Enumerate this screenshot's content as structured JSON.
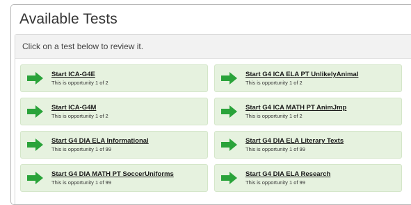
{
  "title": "Available Tests",
  "instructions": "Click on a test below to review it.",
  "tests": [
    {
      "label": "Start ICA-G4E",
      "subtitle": "This is opportunity 1 of 2"
    },
    {
      "label": "Start G4 ICA ELA PT UnlikelyAnimal",
      "subtitle": "This is opportunity 1 of 2"
    },
    {
      "label": "Start ICA-G4M",
      "subtitle": "This is opportunity 1 of 2"
    },
    {
      "label": "Start G4 ICA MATH PT AnimJmp",
      "subtitle": "This is opportunity 1 of 2"
    },
    {
      "label": "Start G4 DIA ELA Informational",
      "subtitle": "This is opportunity 1 of 99"
    },
    {
      "label": "Start G4 DIA ELA Literary Texts",
      "subtitle": "This is opportunity 1 of 99"
    },
    {
      "label": "Start G4 DIA MATH PT SoccerUniforms",
      "subtitle": "This is opportunity 1 of 99"
    },
    {
      "label": "Start G4 DIA ELA Research",
      "subtitle": "This is opportunity 1 of 99"
    }
  ],
  "colors": {
    "tile_background": "#e6f2df",
    "arrow_green": "#2aa33a"
  },
  "icons": {
    "tile_icon": "right-arrow-icon"
  }
}
